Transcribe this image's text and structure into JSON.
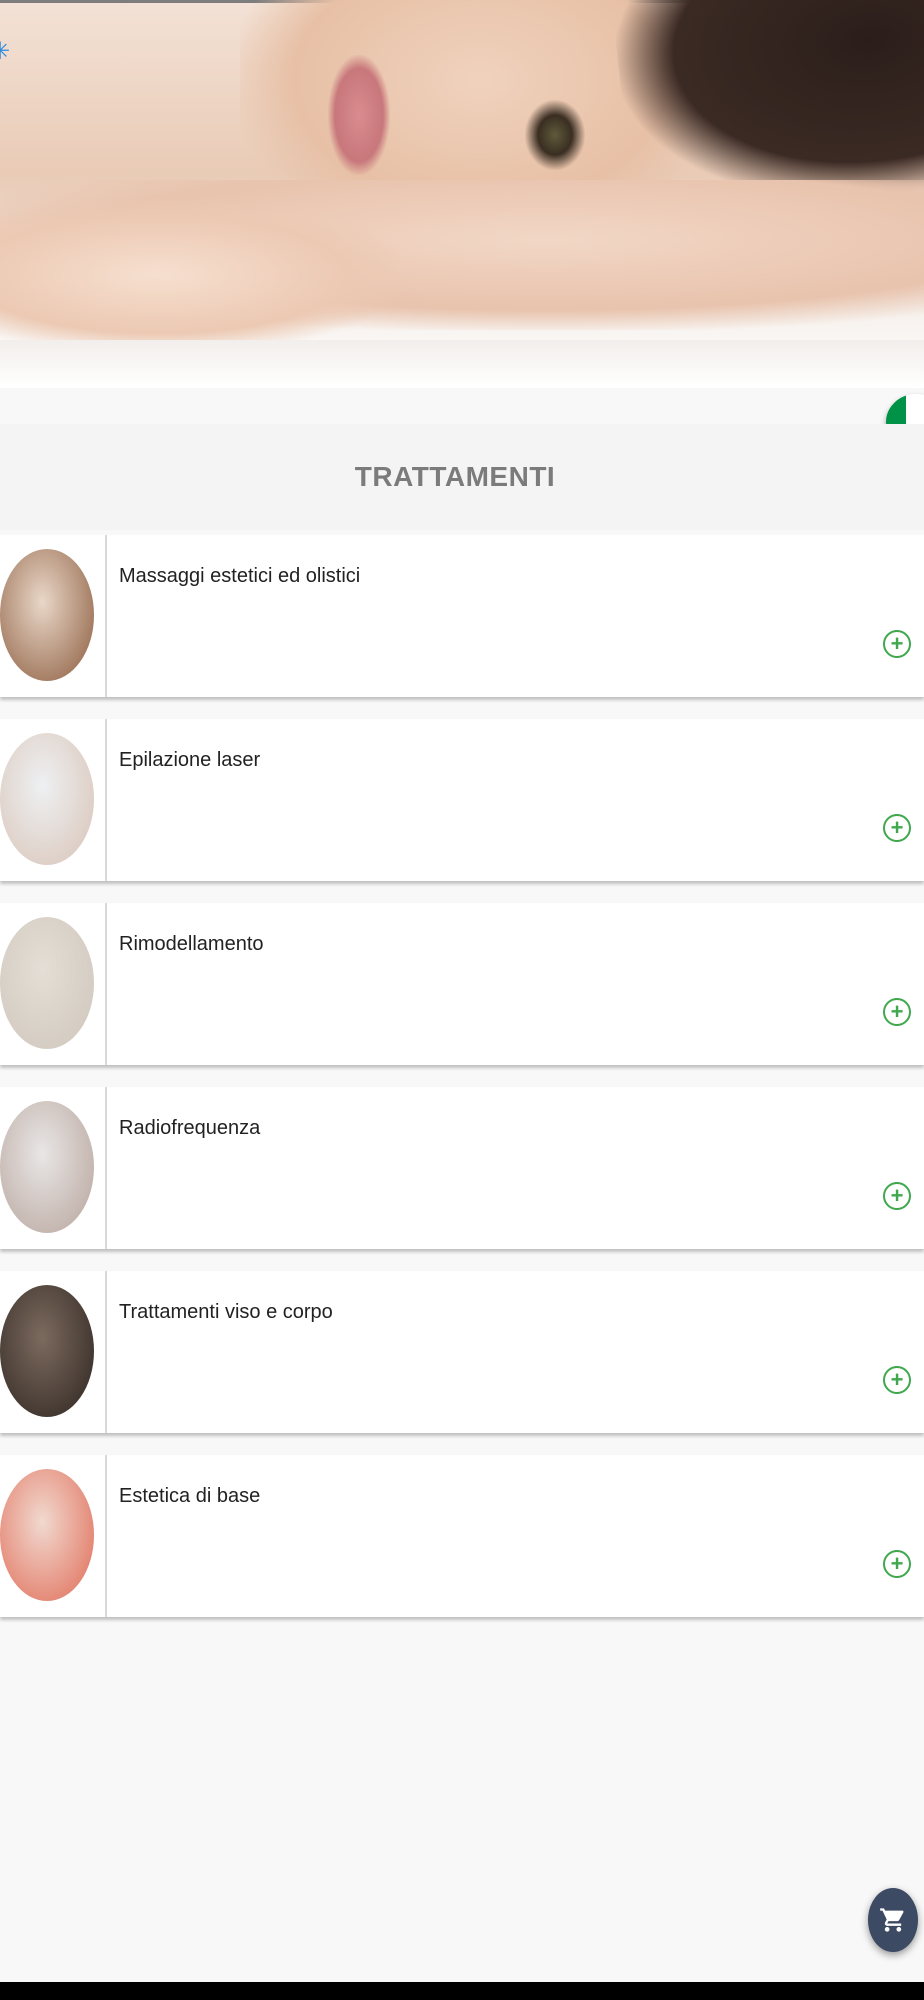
{
  "hero": {
    "image": "woman-lying-on-arms-spa-photo"
  },
  "status": {
    "loading_icon": "spinner-icon"
  },
  "language": {
    "flag": "italy-flag-icon",
    "colors": [
      "#009246",
      "#ffffff",
      "#ce2b37"
    ]
  },
  "header": {
    "title": "TRATTAMENTI"
  },
  "treatments": [
    {
      "label": "Massaggi estetici ed olistici",
      "image": "massage-photo",
      "tone": [
        "#e9d7c8",
        "#8a5a3c"
      ]
    },
    {
      "label": "Epilazione laser",
      "image": "laser-hair-removal-photo",
      "tone": [
        "#eef0f2",
        "#d8c3b6"
      ]
    },
    {
      "label": "Rimodellamento",
      "image": "body-remodeling-photo",
      "tone": [
        "#e4ded6",
        "#cfc6bb"
      ]
    },
    {
      "label": "Radiofrequenza",
      "image": "radiofrequency-facial-photo",
      "tone": [
        "#e8e6e6",
        "#b7a39a"
      ]
    },
    {
      "label": "Trattamenti viso e corpo",
      "image": "eye-before-after-photo",
      "tone": [
        "#7c6a5e",
        "#2d2520"
      ]
    },
    {
      "label": "Estetica di base",
      "image": "manicure-photo",
      "tone": [
        "#f1d9cf",
        "#e06a55"
      ]
    }
  ],
  "actions": {
    "add_icon": "plus-circle-icon",
    "cart_icon": "shopping-cart-icon"
  },
  "colors": {
    "accent_green": "#3fa84e",
    "cart_button": "#3d4a63",
    "title_gray": "#7b7b7b"
  }
}
